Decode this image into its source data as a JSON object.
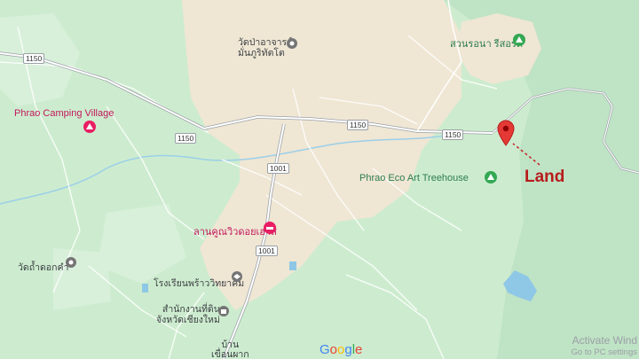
{
  "colors": {
    "urban": "#efe6d4",
    "forest": "#d3ecd7",
    "grass": "#c5e8c9",
    "water": "#8fc8e6",
    "road_main": "#ffffff",
    "road_outline": "#9aa0a6",
    "pin_red": "#e53935",
    "label_land": "#b71c1c"
  },
  "pois": [
    {
      "label": "Phrao Camping Village",
      "type": "campground",
      "icon": "tent-icon"
    },
    {
      "label": "วัดป่าอาจารย์\nมั่นภูริทัตโต",
      "type": "temple",
      "icon": "temple-icon"
    },
    {
      "label": "สวนรอนา รีสอร์ต",
      "type": "resort",
      "icon": "tent-icon"
    },
    {
      "label": "Phrao Eco Art Treehouse",
      "type": "campground",
      "icon": "tent-icon"
    },
    {
      "label": "ลานคูณวิวดอยเฮาส์",
      "type": "hotel",
      "icon": "bed-icon"
    },
    {
      "label": "วัดถ้ำดอกคำ",
      "type": "temple",
      "icon": "temple-icon"
    },
    {
      "label": "โรงเรียนพร้าววิทยาคม",
      "type": "school",
      "icon": "school-icon"
    },
    {
      "label": "สำนักงานที่ดิน\nจังหวัดเชียงใหม่",
      "type": "government",
      "icon": "government-icon"
    },
    {
      "label": "บ้าน\nเขื่อนผาก",
      "type": "village",
      "icon": "none"
    }
  ],
  "road_shields": [
    "1150",
    "1150",
    "1150",
    "1150",
    "1001",
    "1001"
  ],
  "marker": {
    "label": "Land",
    "icon": "red-pin-icon"
  },
  "branding": {
    "logo": "Google"
  },
  "watermark": {
    "line1": "Activate Wind",
    "line2": "Go to PC settings"
  }
}
